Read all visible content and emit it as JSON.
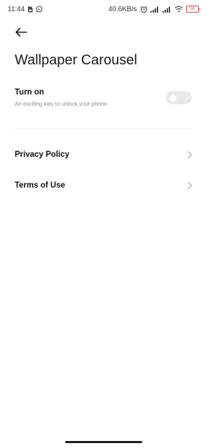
{
  "status_bar": {
    "time": "11:44",
    "network_speed": "40.6KB/s",
    "battery_level": "16",
    "icons_left": [
      "sim-card-icon",
      "whatsapp-icon"
    ],
    "icons_right": [
      "alarm-icon",
      "signal-icon",
      "signal-icon",
      "wifi-icon",
      "battery-icon"
    ]
  },
  "header": {
    "back_icon": "arrow-left-icon",
    "title": "Wallpaper Carousel"
  },
  "toggle": {
    "title": "Turn on",
    "subtitle": "An exciting way to unlock your phone",
    "state": "off"
  },
  "menu": {
    "items": [
      {
        "label": "Privacy Policy",
        "icon": "chevron-right-icon"
      },
      {
        "label": "Terms of Use",
        "icon": "chevron-right-icon"
      }
    ]
  }
}
